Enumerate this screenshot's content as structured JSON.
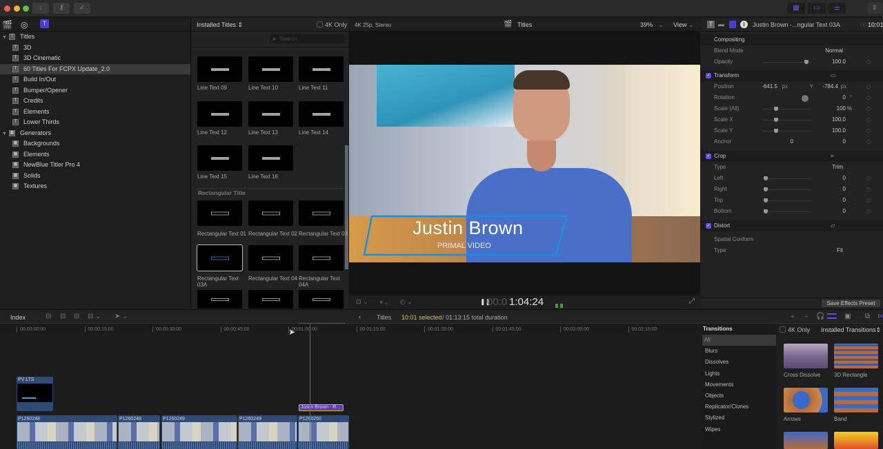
{
  "toolbar": {
    "import_icon": "↓",
    "keywords_icon": "⚷",
    "background_tasks_icon": "✓",
    "browser_toggle": "▦",
    "timeline_toggle": "▭",
    "inspector_toggle": "⚌",
    "share_icon": "⇪"
  },
  "sidebar": {
    "tabs": [
      "libraries",
      "photos-audio",
      "titles-generators"
    ],
    "items": [
      {
        "label": "Titles",
        "group": true,
        "expanded": true
      },
      {
        "label": "3D"
      },
      {
        "label": "3D Cinematic"
      },
      {
        "label": "60 Titles For FCPX Update_2.0",
        "selected": true
      },
      {
        "label": "Build In/Out"
      },
      {
        "label": "Bumper/Opener"
      },
      {
        "label": "Credits"
      },
      {
        "label": "Elements"
      },
      {
        "label": "Lower Thirds"
      },
      {
        "label": "Generators",
        "group": true,
        "expanded": true
      },
      {
        "label": "Backgrounds"
      },
      {
        "label": "Elements"
      },
      {
        "label": "NewBlue Titler Pro 4"
      },
      {
        "label": "Solids"
      },
      {
        "label": "Textures"
      }
    ]
  },
  "browser": {
    "filter_label": "Installed Titles",
    "fourk_label": "4K Only",
    "search_placeholder": "Search",
    "section_rectangular": "Rectangular Title",
    "line_items": [
      "Line Text 09",
      "Line Text 10",
      "Line Text 11",
      "Line Text 12",
      "Line Text 13",
      "Line Text 14",
      "Line Text 15",
      "Line Text 16"
    ],
    "rect_items": [
      "Rectangular Text 01",
      "Rectangular Text 02",
      "Rectangular Text 03",
      "Rectangular Text 03A",
      "Rectangular Text 04",
      "Rectangular Text 04A"
    ],
    "selected_item": "Rectangular Text 03A"
  },
  "viewer": {
    "format": "4K 25p, Stereo",
    "title": "Titles",
    "zoom": "39%",
    "view_label": "View",
    "lower_third_name": "Justin Brown",
    "lower_third_sub": "PRIMAL VIDEO",
    "timecode_dim": "00:0",
    "timecode": "1:04:24",
    "accent": "#1a8fe0"
  },
  "inspector": {
    "clip_title": "Justin Brown -...ngular Text 03A",
    "duration_dim": "00:00",
    "duration": "10:01",
    "compositing": "Compositing",
    "blend_mode_label": "Blend Mode",
    "blend_mode": "Normal",
    "opacity_label": "Opacity",
    "opacity": "100.0",
    "transform": "Transform",
    "position_label": "Position",
    "position_x": "-641.5",
    "position_y": "-784.4",
    "px": "px",
    "y_label": "Y",
    "rotation_label": "Rotation",
    "rotation": "0",
    "deg": "°",
    "scale_all_label": "Scale (All)",
    "scale_all": "100",
    "pct": "%",
    "scale_x_label": "Scale X",
    "scale_x": "100.0",
    "scale_y_label": "Scale Y",
    "scale_y": "100.0",
    "anchor_label": "Anchor",
    "anchor_x": "0",
    "anchor_y": "0",
    "crop": "Crop",
    "crop_type_label": "Type",
    "crop_type": "Trim",
    "left_label": "Left",
    "left": "0",
    "right_label": "Right",
    "right": "0",
    "top_label": "Top",
    "top": "0",
    "bottom_label": "Bottom",
    "bottom": "0",
    "distort": "Distort",
    "spatial_conform": "Spatial Conform",
    "sc_type_label": "Type",
    "sc_type": "Fit",
    "save_preset": "Save Effects Preset",
    "checkbox_color": "#5b4fe0"
  },
  "timeline": {
    "index_label": "Index",
    "project": "Titles",
    "selected": "10:01 selected",
    "total": "/ 01:13:15 total duration",
    "ticks": [
      "00:00:00:00",
      "00:00:15:00",
      "00:00:30:00",
      "00:00:45:00",
      "00:01:00:00",
      "00:01:15:00",
      "00:01:30:00",
      "00:01:45:00",
      "00:02:00:00",
      "00:02:15:00"
    ],
    "connected_clip": "PV LTS",
    "title_clip": "Justin Brown - R...",
    "clips": [
      "P1260248",
      "P1260248",
      "P1260249",
      "P1260249",
      "P1260250"
    ],
    "selected_color": "#e3b21a",
    "playhead_color": "#d0403a"
  },
  "transitions": {
    "header": "Transitions",
    "fourk_label": "4K Only",
    "filter_label": "Installed Transitions",
    "categories": [
      "All",
      "Blurs",
      "Dissolves",
      "Lights",
      "Movements",
      "Objects",
      "Replicator/Clones",
      "Stylized",
      "Wipes"
    ],
    "selected_category": "All",
    "items": [
      "Cross Dissolve",
      "3D Rectangle",
      "Arrows",
      "Band"
    ]
  }
}
